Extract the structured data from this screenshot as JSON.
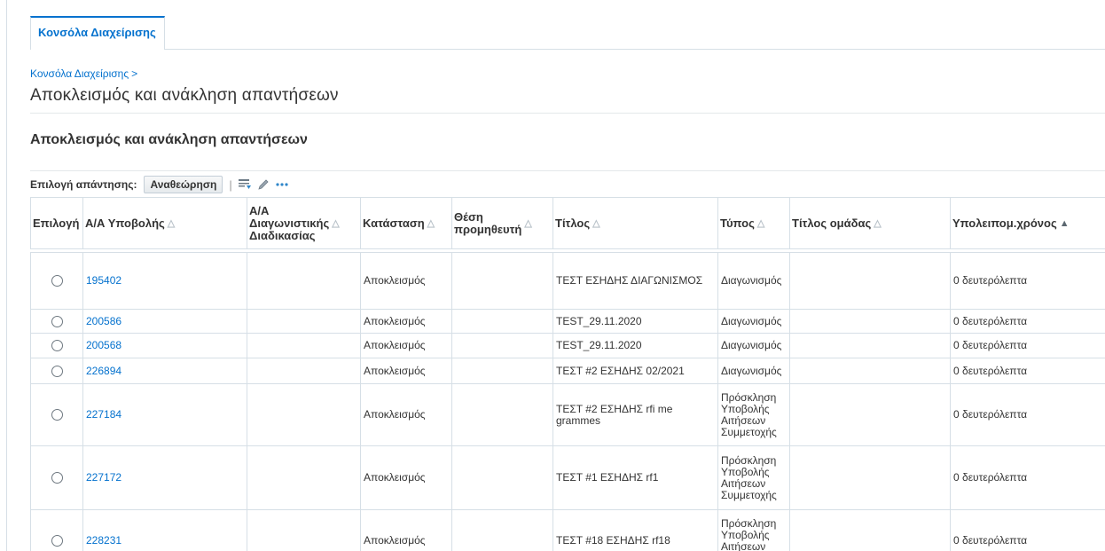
{
  "tabs": [
    {
      "label": "Κονσόλα Διαχείρισης"
    }
  ],
  "breadcrumb": {
    "label": "Κονσόλα Διαχείρισης",
    "separator": ">"
  },
  "page_title": "Αποκλεισμός και ανάκληση απαντήσεων",
  "section_title": "Αποκλεισμός και ανάκληση απαντήσεων",
  "toolbar": {
    "label": "Επιλογή απάντησης:",
    "review_button": "Αναθεώρηση",
    "separator": "|",
    "icons": [
      "export-icon",
      "edit-icon",
      "more-icon"
    ]
  },
  "table": {
    "headers": {
      "select": "Επιλογή",
      "submission": "Α/Α Υποβολής",
      "auction": [
        "Α/Α",
        "Διαγωνιστικής",
        "Διαδικασίας"
      ],
      "status": "Κατάσταση",
      "position": [
        "Θέση",
        "προμηθευτή"
      ],
      "title": "Τίτλος",
      "type": "Τύπος",
      "group": "Τίτλος ομάδας",
      "remaining": "Υπολειπομ.χρόνος"
    },
    "rows": [
      {
        "submission": "195402",
        "auction": "",
        "status": "Αποκλεισμός",
        "position": "",
        "title": "ΤΕΣΤ ΕΣΗΔΗΣ ΔΙΑΓΩΝΙΣΜΟΣ",
        "type": "Διαγωνισμός",
        "group": "",
        "remaining": "0 δευτερόλεπτα"
      },
      {
        "submission": "200586",
        "auction": "",
        "status": "Αποκλεισμός",
        "position": "",
        "title": "TEST_29.11.2020",
        "type": "Διαγωνισμός",
        "group": "",
        "remaining": "0 δευτερόλεπτα"
      },
      {
        "submission": "200568",
        "auction": "",
        "status": "Αποκλεισμός",
        "position": "",
        "title": "TEST_29.11.2020",
        "type": "Διαγωνισμός",
        "group": "",
        "remaining": "0 δευτερόλεπτα"
      },
      {
        "submission": "226894",
        "auction": "",
        "status": "Αποκλεισμός",
        "position": "",
        "title": "ΤΕΣΤ #2 ΕΣΗΔΗΣ 02/2021",
        "type": "Διαγωνισμός",
        "group": "",
        "remaining": "0 δευτερόλεπτα"
      },
      {
        "submission": "227184",
        "auction": "",
        "status": "Αποκλεισμός",
        "position": "",
        "title": "ΤΕΣΤ #2 ΕΣΗΔΗΣ rfi me grammes",
        "type": "Πρόσκληση Υποβολής Αιτήσεων Συμμετοχής",
        "group": "",
        "remaining": "0 δευτερόλεπτα"
      },
      {
        "submission": "227172",
        "auction": "",
        "status": "Αποκλεισμός",
        "position": "",
        "title": "ΤΕΣΤ #1 ΕΣΗΔΗΣ rf1",
        "type": "Πρόσκληση Υποβολής Αιτήσεων Συμμετοχής",
        "group": "",
        "remaining": "0 δευτερόλεπτα"
      },
      {
        "submission": "228231",
        "auction": "",
        "status": "Αποκλεισμός",
        "position": "",
        "title": "ΤΕΣΤ #18 ΕΣΗΔΗΣ rf18",
        "type": "Πρόσκληση Υποβολής Αιτήσεων Συμμετοχής",
        "group": "",
        "remaining": "0 δευτερόλεπτα"
      }
    ]
  },
  "colors": {
    "accent": "#0572ce",
    "text": "#333333",
    "border": "#d6dfe6"
  }
}
